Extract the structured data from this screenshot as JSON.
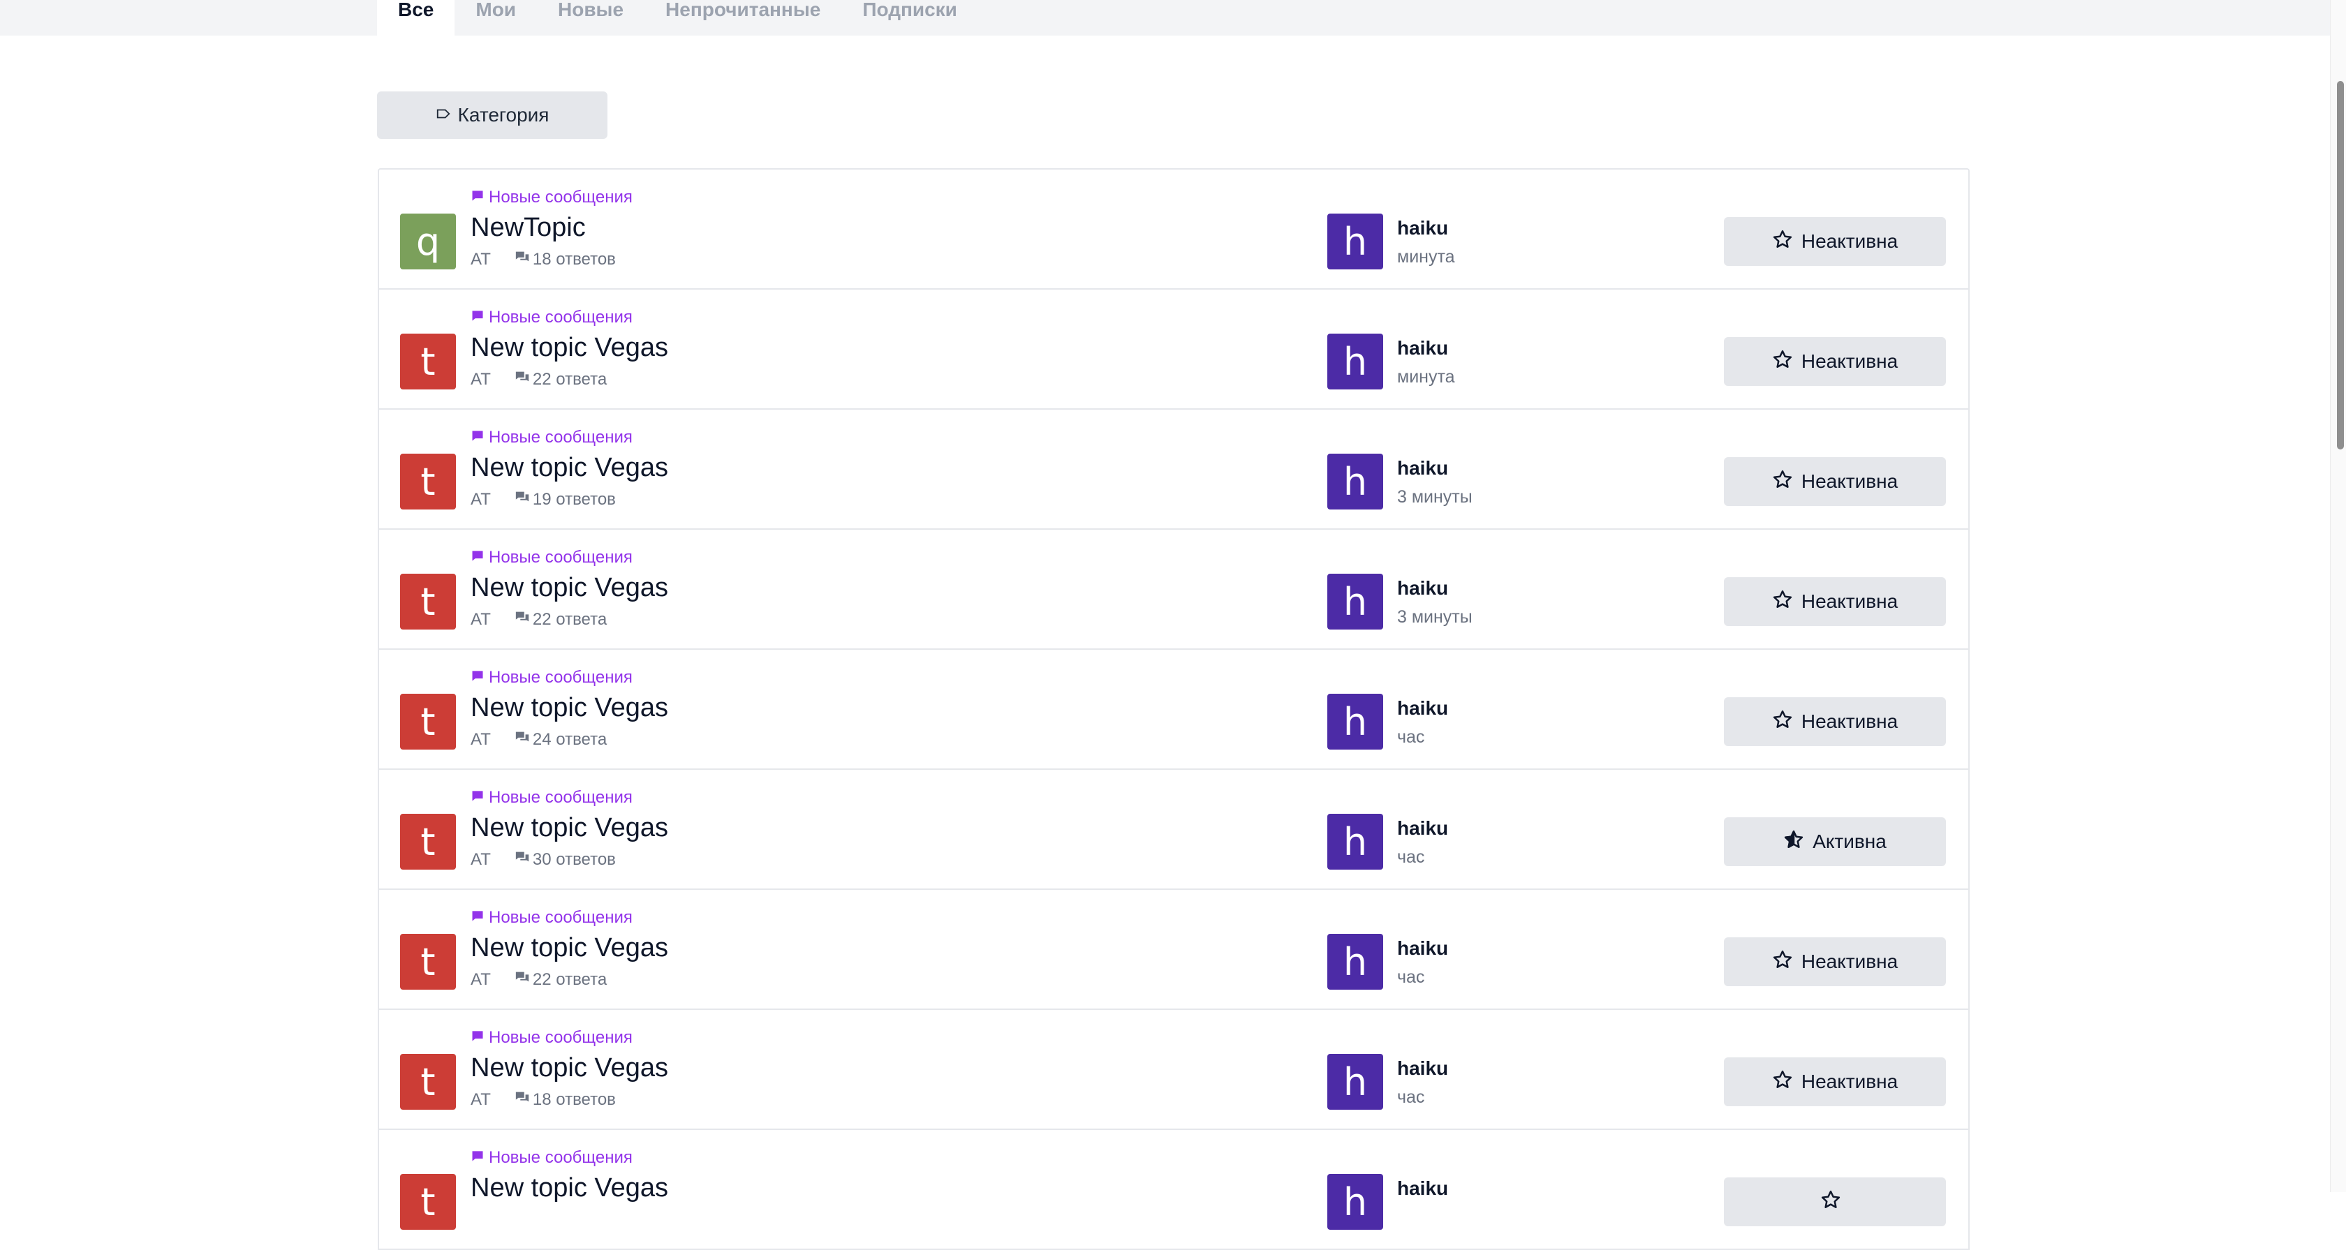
{
  "tabs": [
    {
      "label": "Все",
      "active": true
    },
    {
      "label": "Мои",
      "active": false
    },
    {
      "label": "Новые",
      "active": false
    },
    {
      "label": "Непрочитанные",
      "active": false
    },
    {
      "label": "Подписки",
      "active": false
    }
  ],
  "filter": {
    "category_label": "Категория",
    "icon": "tag-icon"
  },
  "colors": {
    "accent_purple": "#9333ea",
    "user_avatar": "#4c2ba6",
    "topic_avatar_green": "#7ba05b",
    "topic_avatar_red": "#cc3d36"
  },
  "topics": [
    {
      "badge": "Новые сообщения",
      "avatar_letter": "q",
      "avatar_color": "#7ba05b",
      "title": "NewTopic",
      "category": "AT",
      "replies": "18 ответов",
      "user_letter": "h",
      "user": "haiku",
      "time": "минута",
      "status": "Неактивна",
      "active": false
    },
    {
      "badge": "Новые сообщения",
      "avatar_letter": "t",
      "avatar_color": "#cc3d36",
      "title": "New topic Vegas",
      "category": "AT",
      "replies": "22 ответа",
      "user_letter": "h",
      "user": "haiku",
      "time": "минута",
      "status": "Неактивна",
      "active": false
    },
    {
      "badge": "Новые сообщения",
      "avatar_letter": "t",
      "avatar_color": "#cc3d36",
      "title": "New topic Vegas",
      "category": "AT",
      "replies": "19 ответов",
      "user_letter": "h",
      "user": "haiku",
      "time": "3 минуты",
      "status": "Неактивна",
      "active": false
    },
    {
      "badge": "Новые сообщения",
      "avatar_letter": "t",
      "avatar_color": "#cc3d36",
      "title": "New topic Vegas",
      "category": "AT",
      "replies": "22 ответа",
      "user_letter": "h",
      "user": "haiku",
      "time": "3 минуты",
      "status": "Неактивна",
      "active": false
    },
    {
      "badge": "Новые сообщения",
      "avatar_letter": "t",
      "avatar_color": "#cc3d36",
      "title": "New topic Vegas",
      "category": "AT",
      "replies": "24 ответа",
      "user_letter": "h",
      "user": "haiku",
      "time": "час",
      "status": "Неактивна",
      "active": false
    },
    {
      "badge": "Новые сообщения",
      "avatar_letter": "t",
      "avatar_color": "#cc3d36",
      "title": "New topic Vegas",
      "category": "AT",
      "replies": "30 ответов",
      "user_letter": "h",
      "user": "haiku",
      "time": "час",
      "status": "Активна",
      "active": true
    },
    {
      "badge": "Новые сообщения",
      "avatar_letter": "t",
      "avatar_color": "#cc3d36",
      "title": "New topic Vegas",
      "category": "AT",
      "replies": "22 ответа",
      "user_letter": "h",
      "user": "haiku",
      "time": "час",
      "status": "Неактивна",
      "active": false
    },
    {
      "badge": "Новые сообщения",
      "avatar_letter": "t",
      "avatar_color": "#cc3d36",
      "title": "New topic Vegas",
      "category": "AT",
      "replies": "18 ответов",
      "user_letter": "h",
      "user": "haiku",
      "time": "час",
      "status": "Неактивна",
      "active": false
    },
    {
      "badge": "Новые сообщения",
      "avatar_letter": "t",
      "avatar_color": "#cc3d36",
      "title": "New topic Vegas",
      "category": "",
      "replies": "",
      "user_letter": "h",
      "user": "haiku",
      "time": "",
      "status": "",
      "active": false
    }
  ]
}
